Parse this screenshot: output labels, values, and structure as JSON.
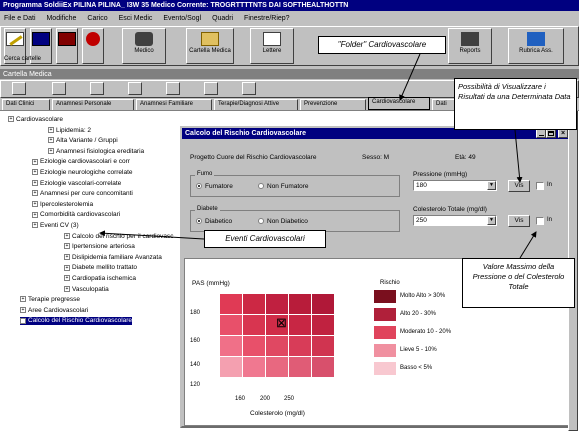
{
  "app": {
    "title": "Programma SoldiiEx  PILINA PILINA_ I3W 35       Medico Corrente: TROGRTTTTNTS DAI  SOFTHEALTHOTTN",
    "menu": [
      "File e Dati",
      "Modifiche",
      "Carico",
      "Esci Medic",
      "Evento/Sogl",
      "Quadri",
      "Finestre/Riep?"
    ]
  },
  "toolbar": [
    {
      "label": "Scrivi",
      "sub": "Cerca cartelle"
    },
    {
      "label": "Salva"
    },
    {
      "label": "Home"
    },
    {
      "label": "Stop"
    },
    {
      "label": "Medico"
    },
    {
      "label": "Cartella Medica"
    },
    {
      "label": "Lettere"
    },
    {
      "label": "Reports"
    },
    {
      "label": "Rubrica Ass."
    }
  ],
  "callouts": {
    "folder": "\"Folder\" Cardiovascolare",
    "date_note": "Possibilità di Visualizzare i Risultati da una Determinata Data",
    "eventi": "Eventi Cardiovascolari",
    "valore": "Valore Massimo della Pressione o del Colesterolo Totale"
  },
  "inner_window": {
    "title": "Cartella Medica",
    "tabs": [
      "Dati Clinici",
      "Anamnesi Personale",
      "Anamnesi Familiare",
      "Terapie/Diagnosi Attive",
      "Prevenzione",
      "Cardiovascolare",
      "Dati"
    ]
  },
  "tree": [
    "Cardiovascolare",
    "Lipidemia: 2",
    "Alta Variante / Gruppi",
    "Anamnesi fisiologica ereditaria",
    "Eziologie cardiovascolari e corr",
    "Eziologie neurologiche correlate",
    "Eziologie vascolari-correlate",
    "Anamnesi per cure concomitanti",
    "Ipercolesterolemia",
    "Comorbidità cardiovascolari",
    "Eventi CV (3)",
    "Calcolo del rischio per il cardiovasc",
    "Ipertensione arteriosa",
    "Dislipidemia familiare Avanzata",
    "Diabete mellito trattato",
    "Cardiopatia ischemica",
    "Vasculopatia",
    "Terapie pregresse",
    "Aree Cardiovascolari",
    "Calcolo del Rischio Cardiovascolare"
  ],
  "dialog": {
    "title": "Calcolo del Rischio Cardiovascolare",
    "header_left": "Progetto Cuore del Rischio Cardiovascolare",
    "header_mid": "Sesso: M",
    "header_right": "Età: 49",
    "group1_label": "Fumo",
    "group1_opt1": "Fumatore",
    "group1_opt2": "Non Fumatore",
    "group2_label": "Diabete",
    "group2_opt1": "Diabetico",
    "group2_opt2": "Non Diabetico",
    "pressure_label": "Pressione (mmHg)",
    "pressure_value": "180",
    "chol_label": "Colesterolo Totale (mg/dl)",
    "chol_value": "250",
    "vis_button": "Vis",
    "checkbox_label": "In",
    "chart_ylabel": "PAS (mmHg)",
    "chart_xlabel": "Colesterolo (mg/dl)",
    "y_ticks": [
      "180",
      "160",
      "140",
      "120"
    ],
    "x_ticks": [
      "160",
      "200",
      "250"
    ],
    "legend_title": "Rischio",
    "legend": [
      {
        "label": "Molto Alto   > 30%",
        "color": "#7a0f1e"
      },
      {
        "label": "Alto 20 - 30%",
        "color": "#b0203a"
      },
      {
        "label": "Moderato 10 - 20%",
        "color": "#e0445c"
      },
      {
        "label": "Lieve 5 - 10%",
        "color": "#f090a0"
      },
      {
        "label": "Basso < 5%",
        "color": "#f8c8d0"
      }
    ],
    "marker": "⊠"
  },
  "heatmap_colors": [
    [
      "#e03a55",
      "#cc2844",
      "#c02040",
      "#b81c3a",
      "#b01838"
    ],
    [
      "#e8506a",
      "#d83550",
      "#d02c48",
      "#c82644",
      "#c02240"
    ],
    [
      "#f07088",
      "#e8506a",
      "#e04862",
      "#d83c58",
      "#d03450"
    ],
    [
      "#f4a0b0",
      "#f07890",
      "#e86880",
      "#e05c76",
      "#d8506c"
    ]
  ]
}
